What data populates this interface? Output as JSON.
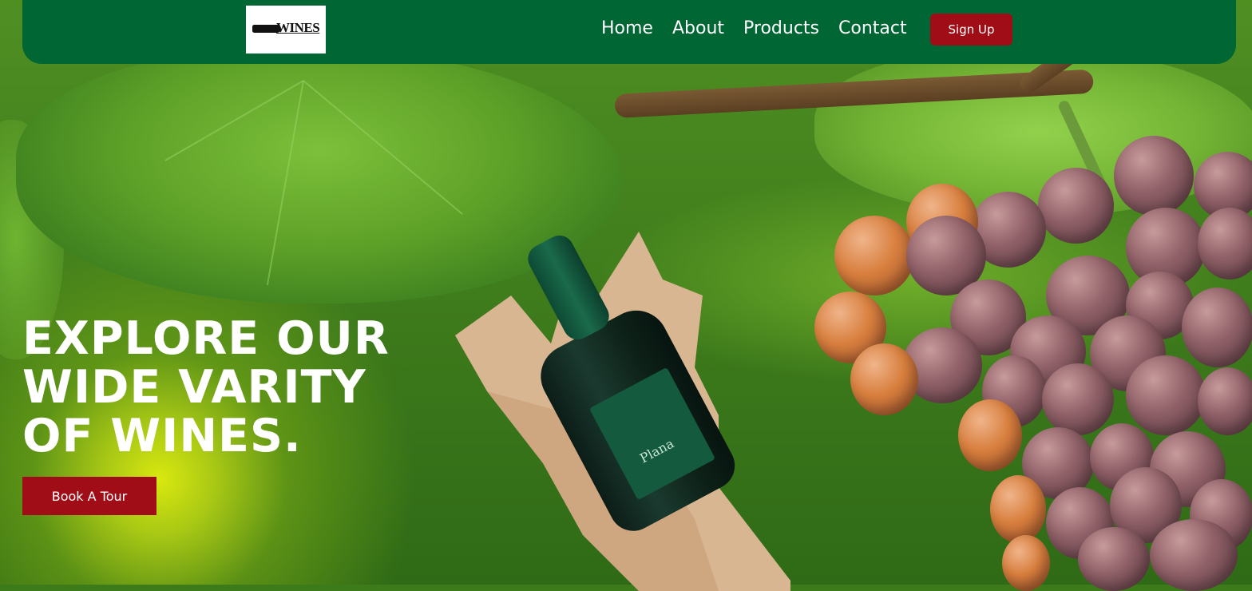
{
  "nav": {
    "logo_text": "WINES",
    "links": [
      "Home",
      "About",
      "Products",
      "Contact"
    ],
    "signup_label": "Sign Up"
  },
  "hero": {
    "headline": "EXPLORE OUR WIDE VARITY OF WINES.",
    "cta_label": "Book A Tour",
    "bottle_label": "Plana"
  },
  "colors": {
    "navbar": "#006633",
    "button": "#a10d16",
    "text": "#ffffff"
  },
  "icons": [
    "wine-bottle-logo-icon"
  ]
}
